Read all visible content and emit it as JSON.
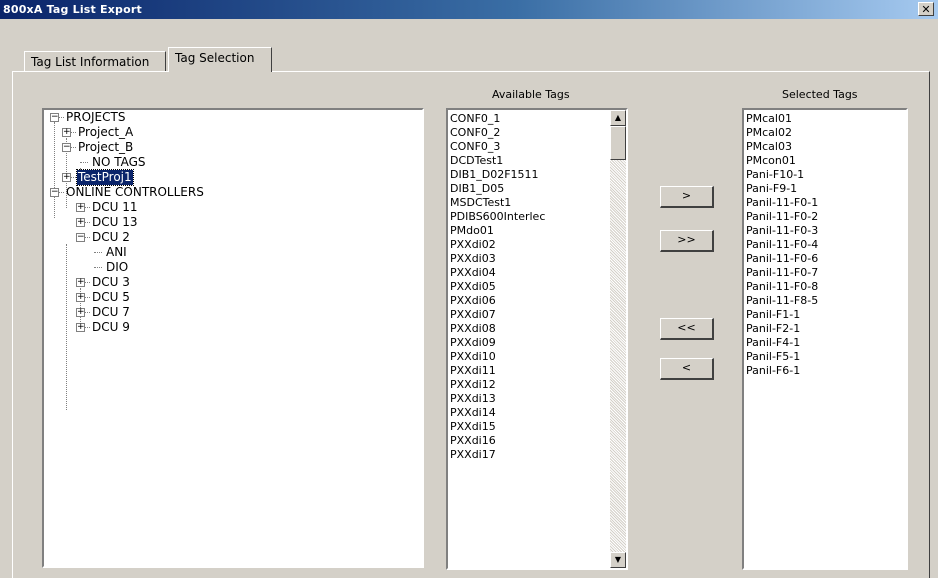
{
  "window": {
    "title": "800xA Tag List Export",
    "close_glyph": "✕"
  },
  "tabs": [
    {
      "label": "Tag List Information"
    },
    {
      "label": "Tag Selection"
    }
  ],
  "tree": {
    "nodes": [
      {
        "label": "PROJECTS",
        "expander": "−"
      },
      {
        "label": "Project_A",
        "expander": "+"
      },
      {
        "label": "Project_B",
        "expander": "−"
      },
      {
        "label": "NO TAGS"
      },
      {
        "label": "TestProj1",
        "expander": "+"
      },
      {
        "label": "ONLINE CONTROLLERS",
        "expander": "−"
      },
      {
        "label": "DCU 11",
        "expander": "+"
      },
      {
        "label": "DCU 13",
        "expander": "+"
      },
      {
        "label": "DCU 2",
        "expander": "−"
      },
      {
        "label": "ANI"
      },
      {
        "label": "DIO"
      },
      {
        "label": "DCU 3",
        "expander": "+"
      },
      {
        "label": "DCU 5",
        "expander": "+"
      },
      {
        "label": "DCU 7",
        "expander": "+"
      },
      {
        "label": "DCU 9",
        "expander": "+"
      }
    ]
  },
  "available": {
    "caption": "Available Tags",
    "items": [
      "CONF0_1",
      "CONF0_2",
      "CONF0_3",
      "DCDTest1",
      "DIB1_D02F1511",
      "DIB1_D05",
      "MSDCTest1",
      "PDIBS600Interlec",
      "PMdo01",
      "PXXdi02",
      "PXXdi03",
      "PXXdi04",
      "PXXdi05",
      "PXXdi06",
      "PXXdi07",
      "PXXdi08",
      "PXXdi09",
      "PXXdi10",
      "PXXdi11",
      "PXXdi12",
      "PXXdi13",
      "PXXdi14",
      "PXXdi15",
      "PXXdi16",
      "PXXdi17"
    ],
    "scroll_up": "▲",
    "scroll_down": "▼"
  },
  "selected": {
    "caption": "Selected Tags",
    "items": [
      "PMcal01",
      "PMcal02",
      "PMcal03",
      "PMcon01",
      "Pani-F10-1",
      "Pani-F9-1",
      "Panil-11-F0-1",
      "Panil-11-F0-2",
      "Panil-11-F0-3",
      "Panil-11-F0-4",
      "Panil-11-F0-6",
      "Panil-11-F0-7",
      "Panil-11-F0-8",
      "Panil-11-F8-5",
      "Panil-F1-1",
      "Panil-F2-1",
      "Panil-F4-1",
      "Panil-F5-1",
      "Panil-F6-1"
    ]
  },
  "buttons": {
    "add": ">",
    "add_all": ">>",
    "remove_all": "<<",
    "remove": "<"
  }
}
